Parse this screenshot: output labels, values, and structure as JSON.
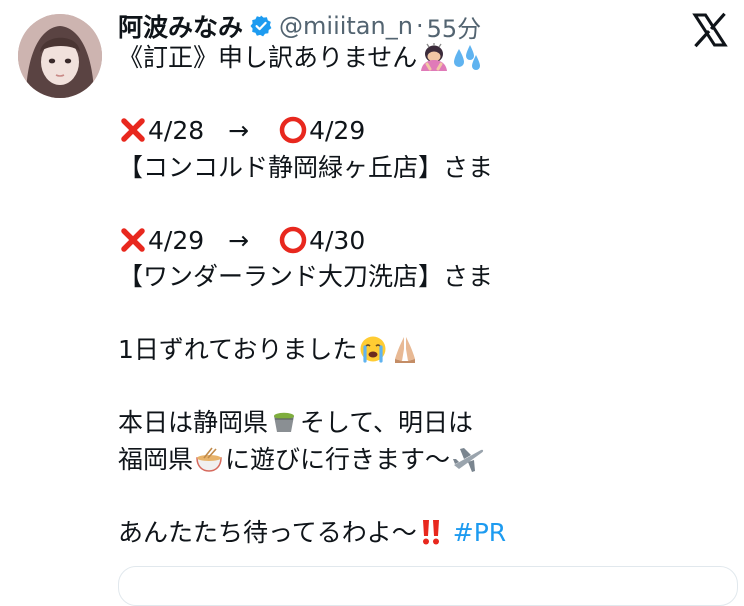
{
  "author": {
    "display_name": "阿波みなみ",
    "handle": "@miiitan_n",
    "separator": "·",
    "time": "55分",
    "verified": true
  },
  "brand": {
    "logo_icon": "x-logo-icon"
  },
  "tweet": {
    "line_correction": "《訂正》申し訳ありません",
    "wrong1": "4/28",
    "arrow1": "→",
    "right1": "4/29",
    "store1": "【コンコルド静岡緑ヶ丘店】さま",
    "wrong2": "4/29",
    "arrow2": "→",
    "right2": "4/30",
    "store2": "【ワンダーランド大刀洗店】さま",
    "shift": "1日ずれておりました",
    "today_a": "本日は静岡県",
    "today_b": "そして、明日は",
    "tomorrow_a": "福岡県",
    "tomorrow_b": "に遊びに行きます〜",
    "closing": "あんたたち待ってるわよ〜",
    "hashtag": "#PR"
  },
  "emoji_names": [
    "bowing-woman-emoji",
    "sweat-droplets-emoji",
    "cross-mark-emoji",
    "red-circle-emoji",
    "crying-face-emoji",
    "folded-hands-emoji",
    "green-tea-emoji",
    "ramen-emoji",
    "airplane-emoji",
    "double-exclamation-emoji"
  ],
  "colors": {
    "text": "#0f1419",
    "secondary": "#536471",
    "verified": "#1d9bf0",
    "hashtag": "#1d9bf0",
    "cross": "#e8281e",
    "circle": "#e8281e"
  }
}
